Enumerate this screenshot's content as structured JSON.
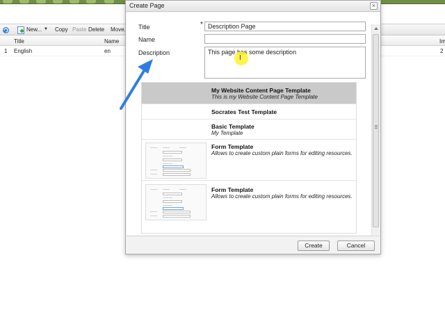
{
  "app": {
    "toolbar": {
      "new_label": "New...",
      "copy_label": "Copy",
      "paste_label": "Paste",
      "delete_label": "Delete",
      "move_label": "Move..."
    },
    "grid": {
      "columns": [
        "Title",
        "Name",
        "Im"
      ],
      "rows": [
        {
          "num": "1",
          "title": "English",
          "name": "en",
          "extra": "2"
        }
      ]
    }
  },
  "dialog": {
    "title": "Create Page",
    "close_glyph": "×",
    "fields": {
      "title_label": "Title",
      "title_required": "*",
      "title_value": "Description Page",
      "name_label": "Name",
      "name_value": "",
      "description_label": "Description",
      "description_value": "This page has some description"
    },
    "templates": [
      {
        "name": "My Website Content Page Template",
        "description": "This is my Website Content Page Template",
        "selected": true
      },
      {
        "name": "Socrates Test Template",
        "description": "",
        "selected": false
      },
      {
        "name": "Basic Template",
        "description": "My Template",
        "selected": false
      },
      {
        "name": "Form Template",
        "description": "Allows to create custom plain forms for editing resources.",
        "selected": false,
        "thumbnail": true
      },
      {
        "name": "Form Template",
        "description": "Allows to create custom plain forms for editing resources.",
        "selected": false,
        "thumbnail": true
      }
    ],
    "buttons": {
      "create": "Create",
      "cancel": "Cancel"
    }
  },
  "colors": {
    "accent_green": "#6f8e46",
    "annotation_arrow": "#2f7de1",
    "cursor_highlight": "#fff32a",
    "selected_row": "#c9c9c9"
  },
  "icons": [
    "refresh-icon",
    "new-page-icon",
    "dropdown-arrow-icon",
    "close-icon",
    "annotation-arrow-icon",
    "text-cursor-icon"
  ]
}
